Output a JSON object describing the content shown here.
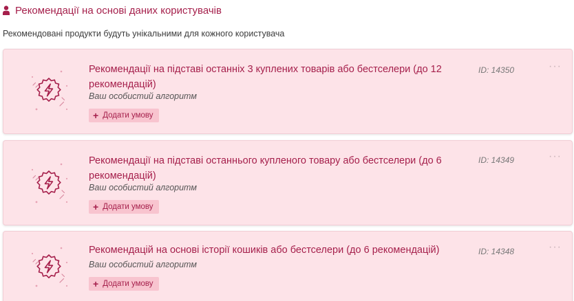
{
  "header": {
    "icon": "user-icon",
    "title": "Рекомендації на основі даних користувачів",
    "subtitle": "Рекомендовані продукти будуть унікальними для кожного користувача"
  },
  "cards": [
    {
      "title": "Рекомендації на підставі останніх 3 куплених товарів або бестселери (до 12 рекомендацій)",
      "subtitle": "Ваш особистий алгоритм",
      "add_label": "Додати умову",
      "id": "ID: 14350",
      "more": "···"
    },
    {
      "title": "Рекомендації на підставі останнього купленого товару або бестселери (до 6 рекомендацій)",
      "subtitle": "Ваш особистий алгоритм",
      "add_label": "Додати умову",
      "id": "ID: 14349",
      "more": "···"
    },
    {
      "title": "Рекомендацій на основі історії кошиків або бестселери (до 6 рекомендацій)",
      "subtitle": "Ваш особистий алгоритм",
      "add_label": "Додати умову",
      "id": "ID: 14348",
      "more": "···"
    }
  ],
  "colors": {
    "accent": "#a51f4b",
    "card_background": "#fde3e8",
    "button_background": "#f8c4cf"
  }
}
